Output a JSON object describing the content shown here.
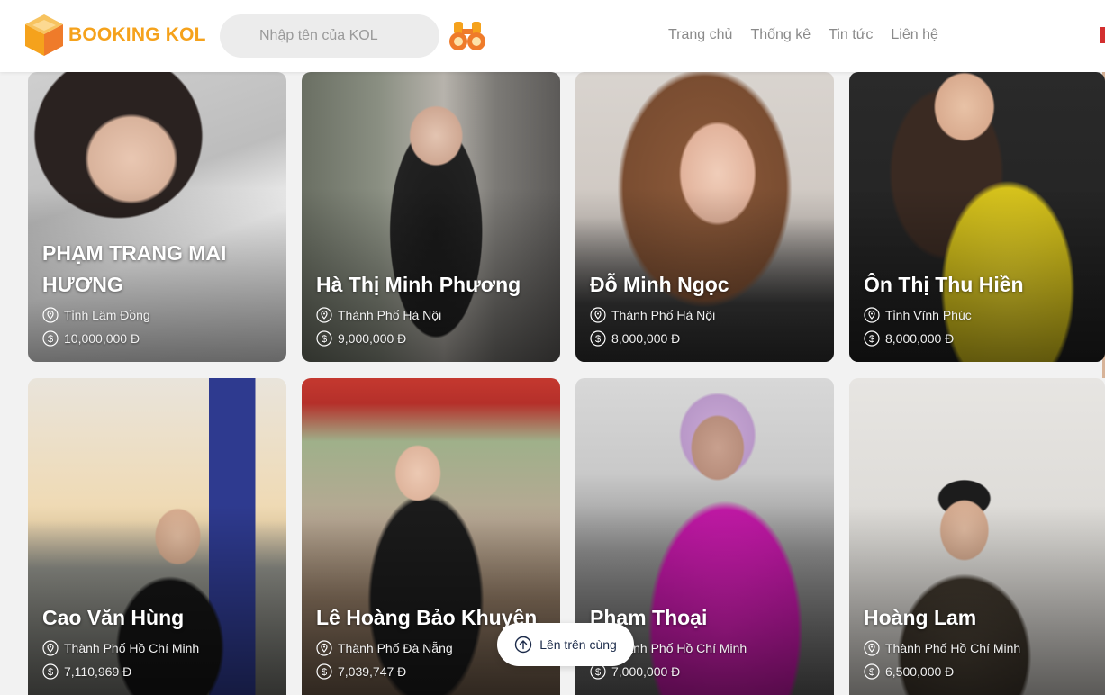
{
  "header": {
    "logo_text": "BOOKING KOL",
    "search_placeholder": "Nhập tên của KOL",
    "nav": [
      "Trang chủ",
      "Thống kê",
      "Tin tức",
      "Liên hệ"
    ]
  },
  "colors": {
    "brand": "#f5a21c",
    "accent": "#ef7b2a"
  },
  "kols": [
    {
      "name": "PHẠM TRANG MAI HƯƠNG",
      "location": "Tỉnh Lâm Đồng",
      "price": "10,000,000 Đ"
    },
    {
      "name": "Hà Thị Minh Phương",
      "location": "Thành Phố Hà Nội",
      "price": "9,000,000 Đ"
    },
    {
      "name": "Đỗ Minh Ngọc",
      "location": "Thành Phố Hà Nội",
      "price": "8,000,000 Đ"
    },
    {
      "name": "Ôn Thị Thu Hiền",
      "location": "Tỉnh Vĩnh Phúc",
      "price": "8,000,000 Đ"
    },
    {
      "name": "Cao Văn Hùng",
      "location": "Thành Phố Hồ Chí Minh",
      "price": "7,110,969 Đ"
    },
    {
      "name": "Lê Hoàng Bảo Khuyên",
      "location": "Thành Phố Đà Nẵng",
      "price": "7,039,747 Đ"
    },
    {
      "name": "Phạm Thoại",
      "location": "Thành Phố Hồ Chí Minh",
      "price": "7,000,000 Đ"
    },
    {
      "name": "Hoàng Lam",
      "location": "Thành Phố Hồ Chí Minh",
      "price": "6,500,000 Đ"
    }
  ],
  "back_to_top": "Lên trên cùng"
}
